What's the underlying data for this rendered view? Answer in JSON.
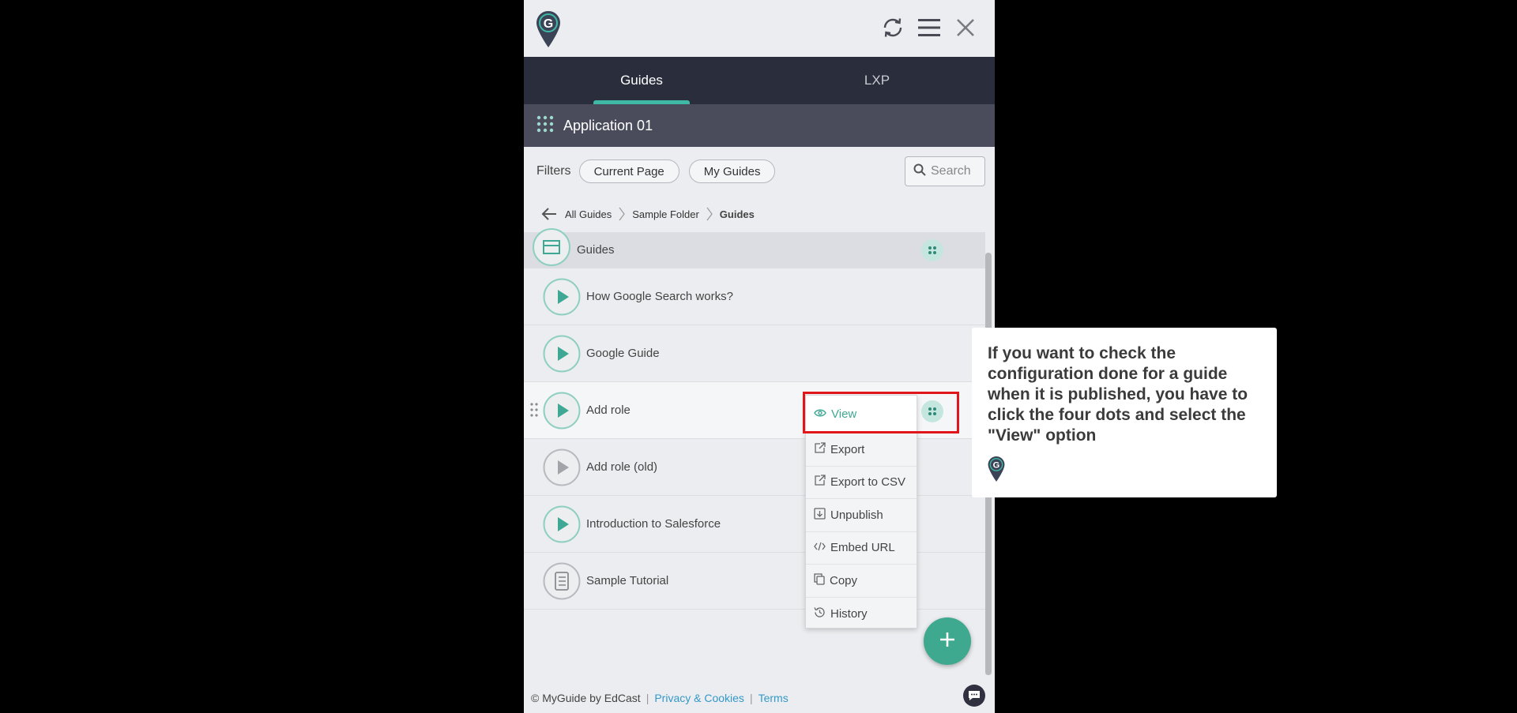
{
  "header": {
    "logo_letter": "G",
    "icons": [
      "refresh-icon",
      "hamburger-menu-icon",
      "close-icon"
    ]
  },
  "tabs": [
    {
      "label": "Guides",
      "active": true
    },
    {
      "label": "LXP",
      "active": false
    }
  ],
  "app": {
    "title": "Application 01"
  },
  "filters": {
    "label": "Filters",
    "chips": [
      "Current Page",
      "My Guides"
    ],
    "search_placeholder": "Search"
  },
  "breadcrumb": {
    "items": [
      "All Guides",
      "Sample Folder"
    ],
    "current": "Guides"
  },
  "folder": {
    "label": "Guides"
  },
  "guides": [
    {
      "label": "How Google Search works?",
      "icon": "play-icon",
      "published": true
    },
    {
      "label": "Google Guide",
      "icon": "play-icon",
      "published": true
    },
    {
      "label": "Add role",
      "icon": "play-icon",
      "published": true
    },
    {
      "label": "Add role (old)",
      "icon": "play-icon",
      "published": false
    },
    {
      "label": "Introduction to Salesforce",
      "icon": "play-icon",
      "published": true
    },
    {
      "label": "Sample Tutorial",
      "icon": "tutorial-icon",
      "published": false
    }
  ],
  "menu": {
    "items": [
      "View",
      "Export",
      "Export to CSV",
      "Unpublish",
      "Embed URL",
      "Copy",
      "History"
    ]
  },
  "footer": {
    "copyright": "© MyGuide by EdCast",
    "privacy": "Privacy & Cookies",
    "terms": "Terms",
    "separator": "|"
  },
  "tooltip": {
    "text": "If you want to check the configuration done for a guide when it is published, you have to click the four dots and select the \"View\" option"
  },
  "colors": {
    "accent": "#3fb8a6",
    "tab_bar": "#2a2d3c",
    "app_bar": "#4a4c5c",
    "highlight": "#e0161a",
    "link": "#3399c7"
  }
}
